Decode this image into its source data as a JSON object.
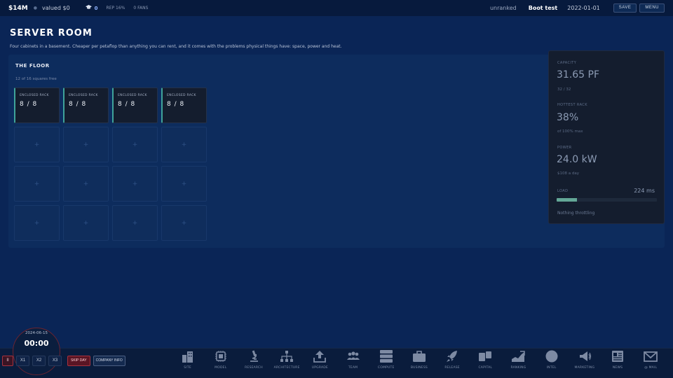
{
  "topbar": {
    "money": "$14M",
    "valued": "valued $0",
    "research_points": "0",
    "rep": "REP 16%",
    "fans": "0 FANS",
    "rank": "unranked",
    "company_name": "Boot test",
    "date": "2022-01-01",
    "save_label": "SAVE",
    "menu_label": "MENU"
  },
  "page": {
    "title": "SERVER ROOM",
    "description": "Four cabinets in a basement. Cheaper per petaflop than anything you can rent, and it comes with the problems physical things have: space, power and heat."
  },
  "floor": {
    "title": "THE FLOOR",
    "free_text": "12 of 16 squares free",
    "racks": [
      {
        "label": "ENCLOSED RACK",
        "count": "8 / 8"
      },
      {
        "label": "ENCLOSED RACK",
        "count": "8 / 8"
      },
      {
        "label": "ENCLOSED RACK",
        "count": "8 / 8"
      },
      {
        "label": "ENCLOSED RACK",
        "count": "8 / 8"
      }
    ],
    "empty_symbol": "+"
  },
  "stats": {
    "capacity_label": "CAPACITY",
    "capacity_value": "31.65 PF",
    "capacity_sub": "32 / 32",
    "hottest_label": "HOTTEST RACK",
    "hottest_value": "38%",
    "hottest_sub": "of 100% max",
    "power_label": "POWER",
    "power_value": "24.0 kW",
    "power_sub": "$108 a day",
    "load_label": "LOAD",
    "load_value": "224 ms",
    "load_fraction": 0.2,
    "throttle_note": "Nothing throttling"
  },
  "clock": {
    "date": "2024-06-15",
    "time": "00:00"
  },
  "controls": {
    "pause": "II",
    "speed1": "X1",
    "speed2": "X2",
    "speed3": "X3",
    "skip_day": "SKIP DAY",
    "company_info": "COMPANY INFO"
  },
  "nav": [
    {
      "label": "SITE",
      "icon": "building-icon"
    },
    {
      "label": "MODEL",
      "icon": "chip-icon"
    },
    {
      "label": "RESEARCH",
      "icon": "microscope-icon"
    },
    {
      "label": "ARCHITECTURE",
      "icon": "hierarchy-icon"
    },
    {
      "label": "UPGRADE",
      "icon": "upload-icon"
    },
    {
      "label": "TEAM",
      "icon": "team-icon"
    },
    {
      "label": "COMPUTE",
      "icon": "server-stack-icon"
    },
    {
      "label": "BUSINESS",
      "icon": "briefcase-icon"
    },
    {
      "label": "RELEASE",
      "icon": "rocket-icon"
    },
    {
      "label": "CAPITAL",
      "icon": "money-icon"
    },
    {
      "label": "RANKING",
      "icon": "chart-up-icon"
    },
    {
      "label": "INTEL",
      "icon": "globe-icon"
    },
    {
      "label": "MARKETING",
      "icon": "megaphone-icon"
    },
    {
      "label": "NEWS",
      "icon": "newspaper-icon"
    },
    {
      "label": "@ MAIL",
      "icon": "mail-icon"
    }
  ],
  "colors": {
    "background": "#0a2556",
    "accent_teal": "#3fa39a",
    "alert_red": "#a7323f"
  }
}
